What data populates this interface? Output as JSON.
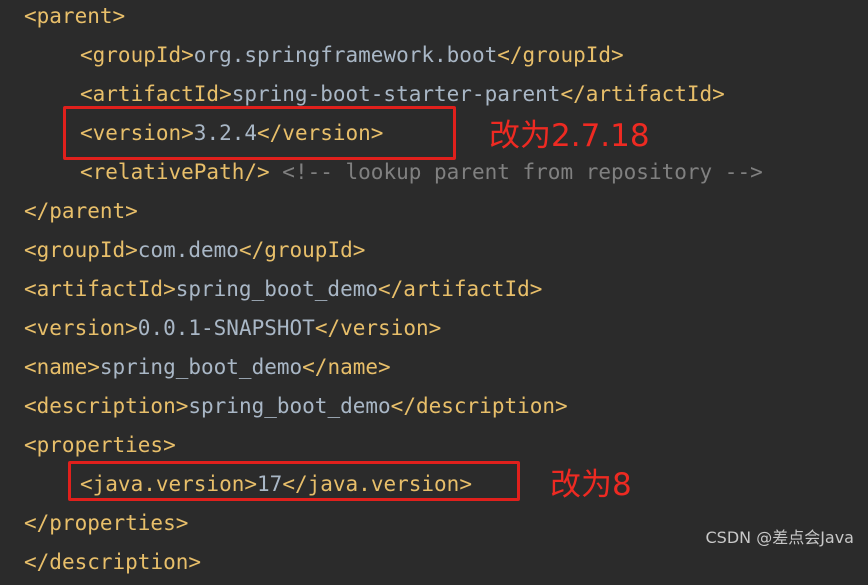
{
  "code_lines": [
    {
      "parts": [
        "<parent>"
      ]
    },
    {
      "parts": [
        "<groupId>",
        "org.springframework.boot",
        "</groupId>"
      ]
    },
    {
      "parts": [
        "<artifactId>",
        "spring-boot-starter-parent",
        "</artifactId>"
      ]
    },
    {
      "parts": [
        "<version>",
        "3.2.4",
        "</version>"
      ]
    },
    {
      "parts": [
        "<relativePath/>",
        " <!-- lookup parent from repository -->"
      ]
    },
    {
      "parts": [
        "</parent>"
      ]
    },
    {
      "parts": [
        "<groupId>",
        "com.demo",
        "</groupId>"
      ]
    },
    {
      "parts": [
        "<artifactId>",
        "spring_boot_demo",
        "</artifactId>"
      ]
    },
    {
      "parts": [
        "<version>",
        "0.0.1-SNAPSHOT",
        "</version>"
      ]
    },
    {
      "parts": [
        "<name>",
        "spring_boot_demo",
        "</name>"
      ]
    },
    {
      "parts": [
        "<description>",
        "spring_boot_demo",
        "</description>"
      ]
    },
    {
      "parts": [
        "<properties>"
      ]
    },
    {
      "parts": [
        "<java.version>",
        "17",
        "</java.version>"
      ]
    },
    {
      "parts": [
        "</properties>"
      ]
    },
    {
      "parts": [
        "</",
        "description",
        ">"
      ]
    }
  ],
  "annotations": {
    "version_note": "改为2.7.18",
    "java_version_note": "改为8"
  },
  "watermark": "CSDN @差点会Java",
  "colors": {
    "background": "#2b2b2b",
    "tag": "#e8bf6a",
    "text": "#a9b7c6",
    "comment": "#808080",
    "annotation_red": "#ee2a22"
  }
}
